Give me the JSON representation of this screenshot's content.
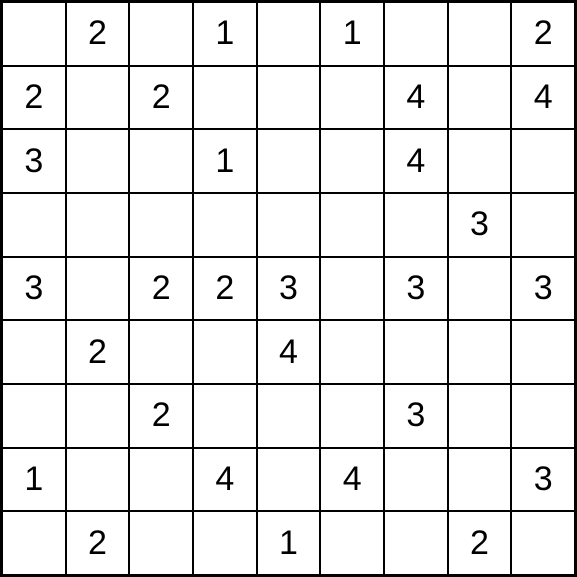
{
  "puzzle": {
    "type": "number-grid",
    "size": 9,
    "rows": [
      [
        "",
        "2",
        "",
        "1",
        "",
        "1",
        "",
        "",
        "2"
      ],
      [
        "2",
        "",
        "2",
        "",
        "",
        "",
        "4",
        "",
        "4"
      ],
      [
        "3",
        "",
        "",
        "1",
        "",
        "",
        "4",
        "",
        ""
      ],
      [
        "",
        "",
        "",
        "",
        "",
        "",
        "",
        "3",
        ""
      ],
      [
        "3",
        "",
        "2",
        "2",
        "3",
        "",
        "3",
        "",
        "3"
      ],
      [
        "",
        "2",
        "",
        "",
        "4",
        "",
        "",
        "",
        ""
      ],
      [
        "",
        "",
        "2",
        "",
        "",
        "",
        "3",
        "",
        ""
      ],
      [
        "1",
        "",
        "",
        "4",
        "",
        "4",
        "",
        "",
        "3"
      ],
      [
        "",
        "2",
        "",
        "",
        "1",
        "",
        "",
        "2",
        ""
      ]
    ]
  }
}
